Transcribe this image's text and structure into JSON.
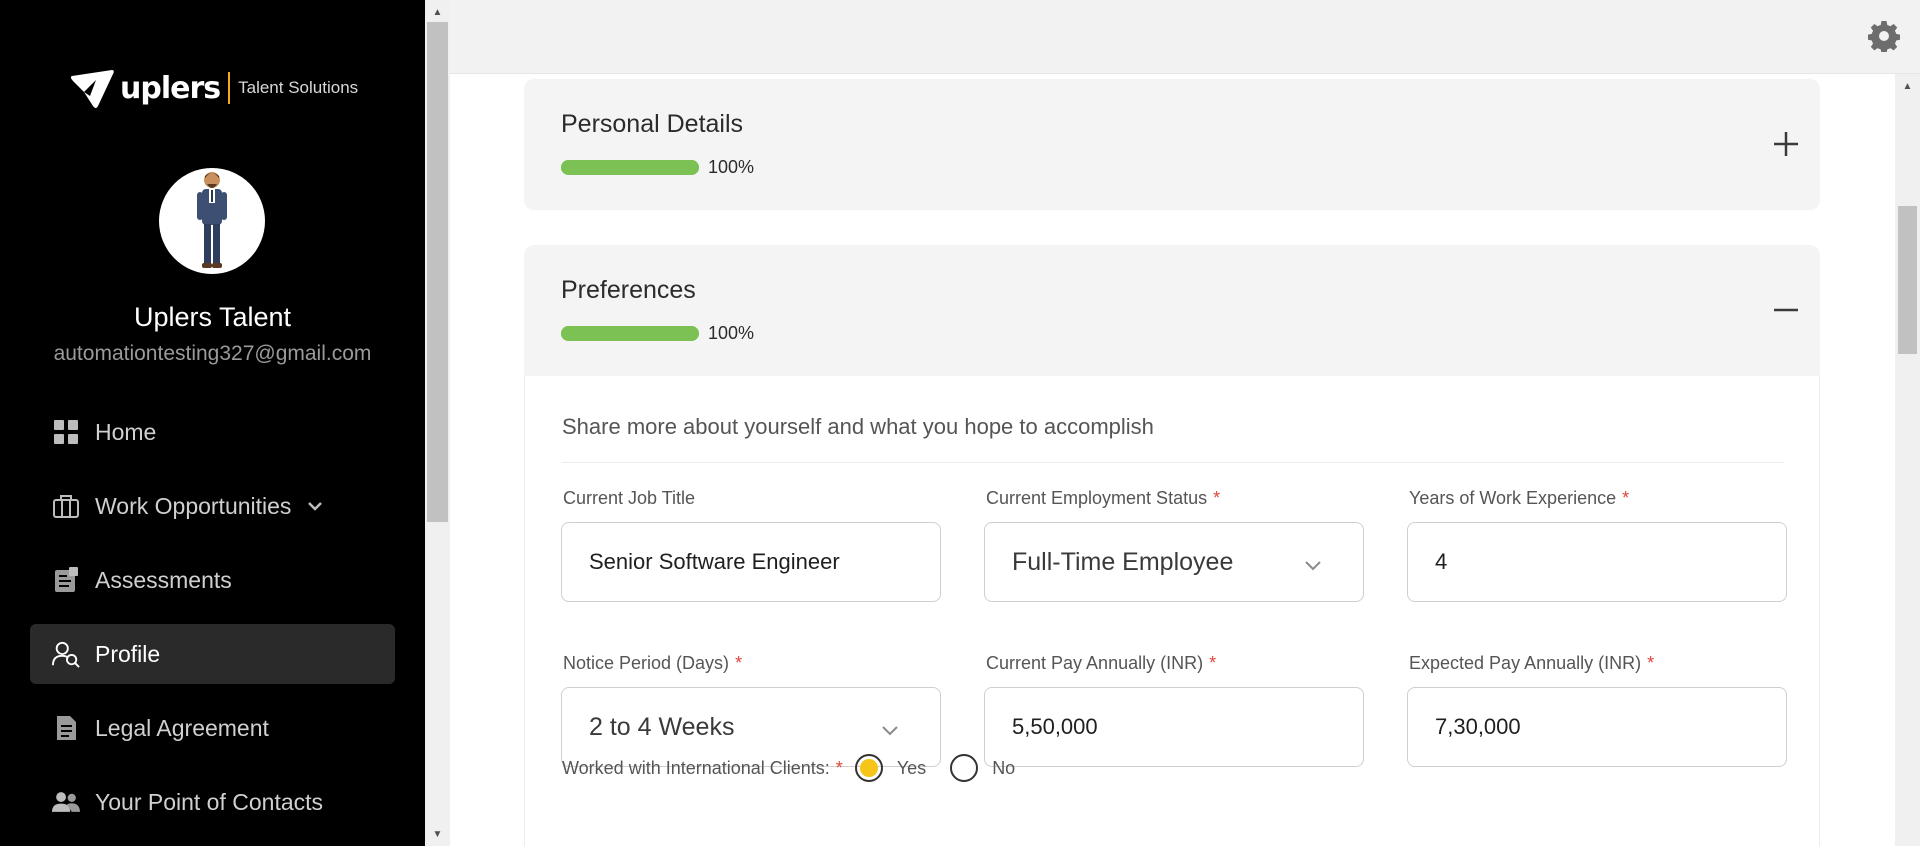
{
  "sidebar": {
    "brand": {
      "name": "uplers",
      "subtitle": "Talent Solutions"
    },
    "user": {
      "name": "Uplers Talent",
      "email": "automationtesting327@gmail.com"
    },
    "nav": [
      {
        "label": "Home",
        "icon": "grid-icon"
      },
      {
        "label": "Work Opportunities",
        "icon": "briefcase-icon",
        "has_chevron": true
      },
      {
        "label": "Assessments",
        "icon": "assessment-icon"
      },
      {
        "label": "Profile",
        "icon": "profile-search-icon",
        "active": true
      },
      {
        "label": "Legal Agreement",
        "icon": "document-icon"
      },
      {
        "label": "Your Point of Contacts",
        "icon": "contacts-icon"
      }
    ]
  },
  "topbar": {
    "icon": "gear-icon"
  },
  "sections": {
    "personal": {
      "title": "Personal Details",
      "progress": 100,
      "progress_label": "100%",
      "toggle": "plus-icon"
    },
    "preferences": {
      "title": "Preferences",
      "progress": 100,
      "progress_label": "100%",
      "toggle": "minus-icon"
    }
  },
  "preferences": {
    "intro": "Share more about yourself and what you hope to accomplish",
    "fields": {
      "job_title": {
        "label": "Current Job Title",
        "value": "Senior Software Engineer",
        "required": false
      },
      "employment_status": {
        "label": "Current Employment Status",
        "value": "Full-Time Employee",
        "required": true
      },
      "experience": {
        "label": "Years of Work Experience",
        "value": "4",
        "required": true
      },
      "notice_period": {
        "label": "Notice Period (Days)",
        "value": "2 to 4 Weeks",
        "required": true
      },
      "current_pay": {
        "label": "Current Pay Annually (INR)",
        "value": "5,50,000",
        "required": true
      },
      "expected_pay": {
        "label": "Expected Pay Annually (INR)",
        "value": "7,30,000",
        "required": true
      }
    },
    "international": {
      "label": "Worked with International Clients:",
      "required": true,
      "options": [
        "Yes",
        "No"
      ],
      "selected": "Yes"
    },
    "required_marker": "*"
  },
  "colors": {
    "sidebar_bg": "#000000",
    "progress": "#7cc154",
    "required": "#e0443a",
    "radio_selected": "#f5c518",
    "logo_accent": "#f5a623"
  }
}
